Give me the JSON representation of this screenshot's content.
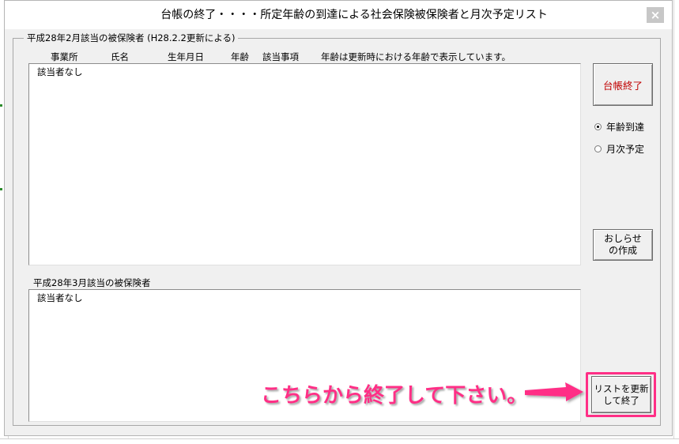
{
  "window": {
    "title": "台帳の終了・・・・所定年齢の到達による社会保険被保険者と月次予定リスト",
    "close_glyph": "×"
  },
  "group": {
    "legend": "平成28年2月該当の被保険者 (H28.2.2更新による)"
  },
  "headers": {
    "office": "事業所",
    "name": "氏名",
    "birthdate": "生年月日",
    "age": "年齢",
    "item": "該当事項",
    "note": "年齢は更新時における年齢で表示しています。"
  },
  "list1": {
    "text": "該当者なし"
  },
  "list2": {
    "label": "平成28年3月該当の被保険者",
    "text": "該当者なし"
  },
  "buttons": {
    "end_ledger": "台帳終了",
    "notice_line1": "おしらせ",
    "notice_line2": "の作成",
    "update_line1": "リストを更新",
    "update_line2": "して終了"
  },
  "radios": {
    "age_reached": "年齢到達",
    "monthly": "月次予定",
    "selected": "age_reached"
  },
  "annotation": {
    "text": "こちらから終了して下さい。",
    "color": "#ff2f86"
  },
  "colors": {
    "end_button_text": "#c00000",
    "window_bg": "#f0f0f0"
  }
}
